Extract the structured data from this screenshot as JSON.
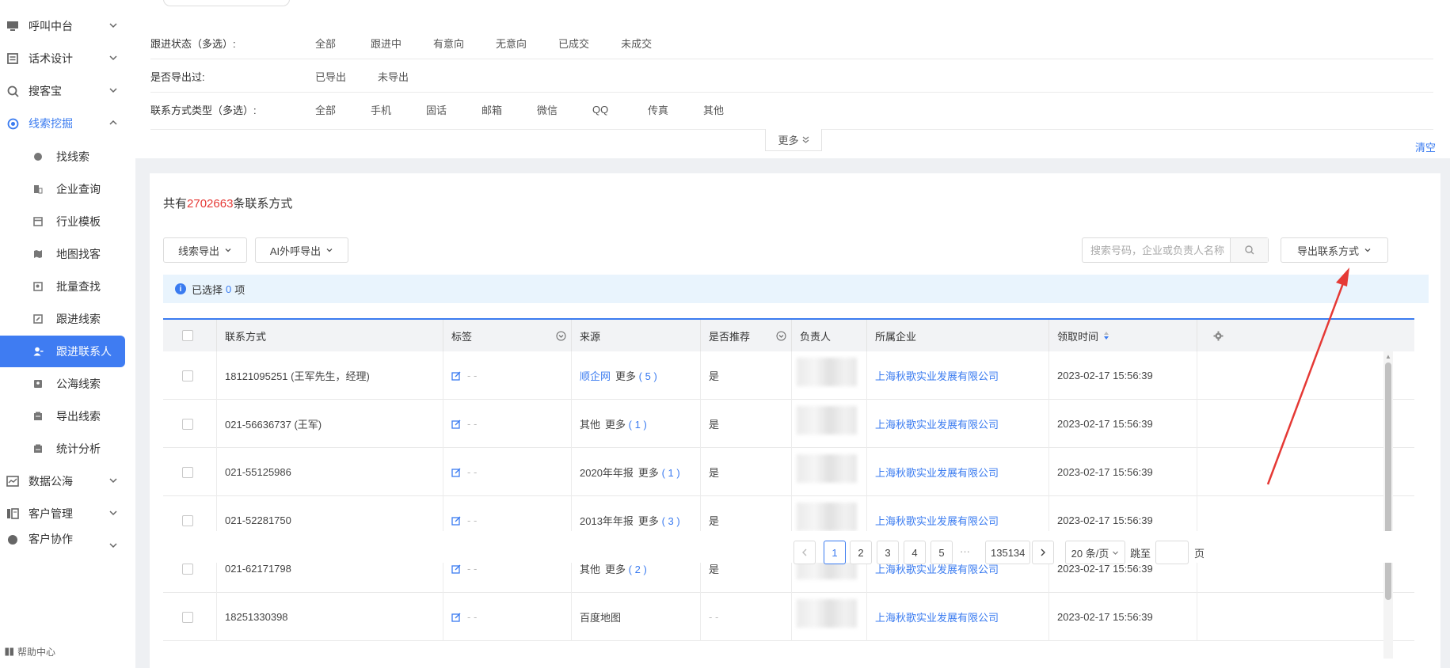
{
  "sidebar": {
    "nav": [
      {
        "label": "呼叫中台",
        "icon": "monitor-icon"
      },
      {
        "label": "话术设计",
        "icon": "document-icon"
      },
      {
        "label": "搜客宝",
        "icon": "magnify-icon"
      },
      {
        "label": "线索挖掘",
        "icon": "target-icon"
      }
    ],
    "sub": [
      {
        "label": "找线索",
        "icon": "search-dot-icon"
      },
      {
        "label": "企业查询",
        "icon": "building-icon"
      },
      {
        "label": "行业模板",
        "icon": "template-icon"
      },
      {
        "label": "地图找客",
        "icon": "map-icon"
      },
      {
        "label": "批量查找",
        "icon": "batch-search-icon"
      },
      {
        "label": "跟进线索",
        "icon": "edit-list-icon"
      },
      {
        "label": "跟进联系人",
        "icon": "contact-person-icon"
      },
      {
        "label": "公海线索",
        "icon": "sea-icon"
      },
      {
        "label": "导出线索",
        "icon": "export-icon"
      },
      {
        "label": "统计分析",
        "icon": "chart-icon"
      }
    ],
    "nav2": [
      {
        "label": "数据公海",
        "icon": "data-icon"
      },
      {
        "label": "客户管理",
        "icon": "customer-icon"
      },
      {
        "label": "客户协作",
        "icon": "collab-icon"
      }
    ],
    "help": "帮助中心"
  },
  "filter": {
    "status_label": "跟进状态（多选）:",
    "status_options": [
      "全部",
      "跟进中",
      "有意向",
      "无意向",
      "已成交",
      "未成交"
    ],
    "exported_label": "是否导出过:",
    "exported_options": [
      "已导出",
      "未导出"
    ],
    "contact_label": "联系方式类型（多选）:",
    "contact_options": [
      "全部",
      "手机",
      "固话",
      "邮箱",
      "微信",
      "QQ",
      "传真",
      "其他"
    ],
    "more": "更多",
    "clear": "清空"
  },
  "main": {
    "total_prefix": "共有",
    "total_count": "2702663",
    "total_suffix": "条联系方式",
    "btn_lead_export": "线索导出",
    "btn_ai_export": "AI外呼导出",
    "search_placeholder": "搜索号码，企业或负责人名称",
    "btn_export_contacts": "导出联系方式",
    "selected_prefix": "已选择",
    "selected_count": "0",
    "selected_suffix": "项"
  },
  "table": {
    "headers": {
      "contact": "联系方式",
      "tag": "标签",
      "source": "来源",
      "recommend": "是否推荐",
      "owner": "负责人",
      "company": "所属企业",
      "time": "领取时间"
    },
    "rows": [
      {
        "contact": "18121095251 (王军先生，经理)",
        "tag": "- -",
        "source": "顺企网",
        "source_link": true,
        "more": "更多",
        "more_count": "( 5 )",
        "recommend": "是",
        "company": "上海秋歌实业发展有限公司",
        "time": "2023-02-17 15:56:39"
      },
      {
        "contact": "021-56636737 (王军)",
        "tag": "- -",
        "source": "其他",
        "source_link": false,
        "more": "更多",
        "more_count": "( 1 )",
        "recommend": "是",
        "company": "上海秋歌实业发展有限公司",
        "time": "2023-02-17 15:56:39"
      },
      {
        "contact": "021-55125986",
        "tag": "- -",
        "source": "2020年年报",
        "source_link": false,
        "more": "更多",
        "more_count": "( 1 )",
        "recommend": "是",
        "company": "上海秋歌实业发展有限公司",
        "time": "2023-02-17 15:56:39"
      },
      {
        "contact": "021-52281750",
        "tag": "- -",
        "source": "2013年年报",
        "source_link": false,
        "more": "更多",
        "more_count": "( 3 )",
        "recommend": "是",
        "company": "上海秋歌实业发展有限公司",
        "time": "2023-02-17 15:56:39"
      },
      {
        "contact": "021-62171798",
        "tag": "- -",
        "source": "其他",
        "source_link": false,
        "more": "更多",
        "more_count": "( 2 )",
        "recommend": "是",
        "company": "上海秋歌实业发展有限公司",
        "time": "2023-02-17 15:56:39"
      },
      {
        "contact": "18251330398",
        "tag": "- -",
        "source": "百度地图",
        "source_link": false,
        "more": "",
        "more_count": "",
        "recommend": "- -",
        "company": "上海秋歌实业发展有限公司",
        "time": "2023-02-17 15:56:39"
      }
    ]
  },
  "pagination": {
    "pages": [
      "1",
      "2",
      "3",
      "4",
      "5"
    ],
    "ellipsis": "···",
    "last": "135134",
    "page_size": "20 条/页",
    "jump_prefix": "跳至",
    "jump_suffix": "页"
  },
  "colors": {
    "accent": "#3a7bf0",
    "count_red": "#e53935",
    "annotation_arrow": "#e53935"
  }
}
